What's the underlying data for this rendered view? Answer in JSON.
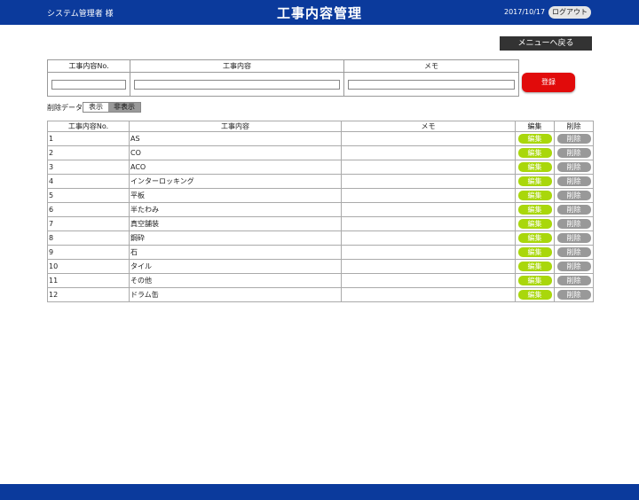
{
  "header": {
    "user": "システム管理者 様",
    "title": "工事内容管理",
    "date": "2017/10/17",
    "logout": "ログアウト"
  },
  "menu_back": "メニューへ戻る",
  "entry_form": {
    "headers": [
      "工事内容No.",
      "工事内容",
      "メモ"
    ],
    "no_value": "",
    "name_value": "",
    "memo_value": "",
    "register": "登録"
  },
  "deleted_filter": {
    "label": "削除データ",
    "show": "表示",
    "hide": "非表示"
  },
  "list": {
    "headers": [
      "工事内容No.",
      "工事内容",
      "メモ",
      "編集",
      "削除"
    ],
    "edit_label": "編集",
    "delete_label": "削除",
    "rows": [
      {
        "no": "1",
        "name": "AS",
        "memo": ""
      },
      {
        "no": "2",
        "name": "CO",
        "memo": ""
      },
      {
        "no": "3",
        "name": "ACO",
        "memo": ""
      },
      {
        "no": "4",
        "name": "インターロッキング",
        "memo": ""
      },
      {
        "no": "5",
        "name": "平板",
        "memo": ""
      },
      {
        "no": "6",
        "name": "半たわみ",
        "memo": ""
      },
      {
        "no": "7",
        "name": "真空舗装",
        "memo": ""
      },
      {
        "no": "8",
        "name": "鋼砕",
        "memo": ""
      },
      {
        "no": "9",
        "name": "石",
        "memo": ""
      },
      {
        "no": "10",
        "name": "タイル",
        "memo": ""
      },
      {
        "no": "11",
        "name": "その他",
        "memo": ""
      },
      {
        "no": "12",
        "name": "ドラム缶",
        "memo": ""
      }
    ]
  },
  "colors": {
    "header_bg": "#0b3a9c",
    "register_bg": "#e10b0b",
    "edit_bg": "#a9d70b",
    "delete_bg": "#999999"
  }
}
